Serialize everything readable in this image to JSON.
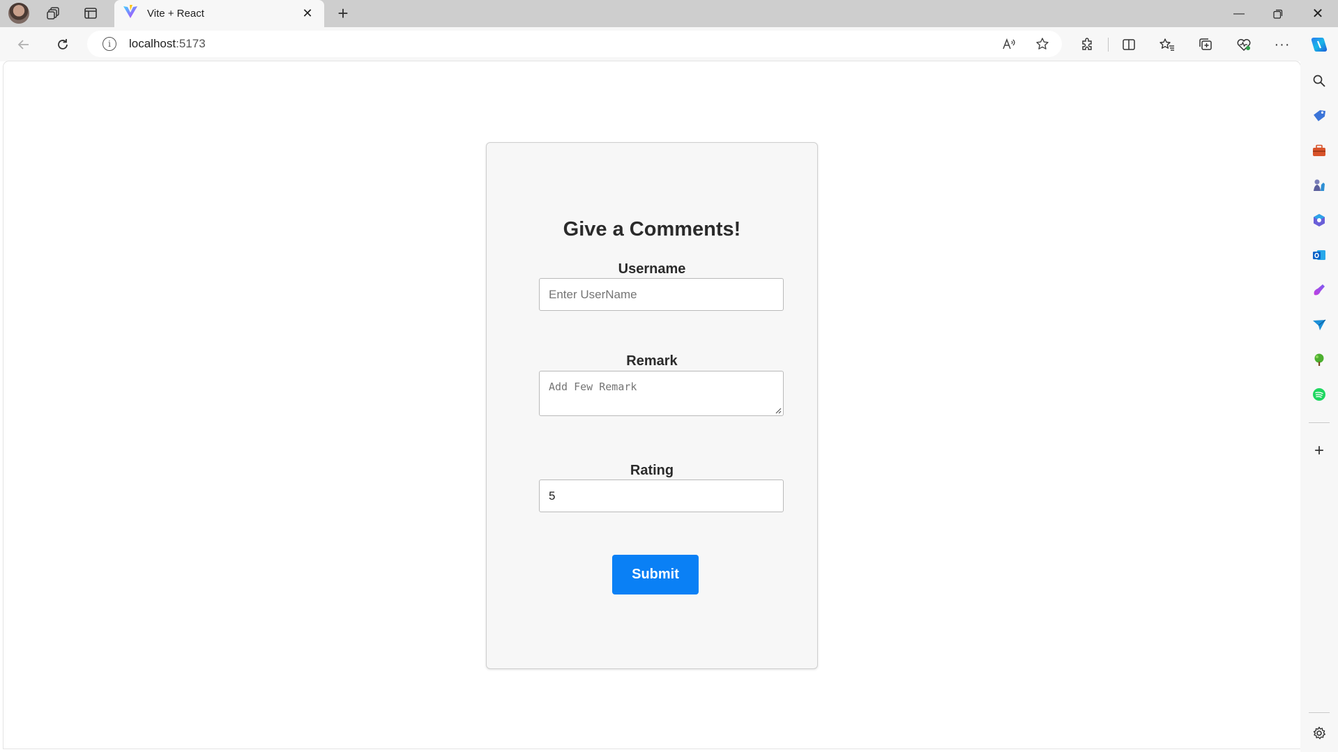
{
  "tab": {
    "title": "Vite + React"
  },
  "address": {
    "host": "localhost",
    "port": ":5173"
  },
  "form": {
    "heading": "Give a Comments!",
    "username_label": "Username",
    "username_placeholder": "Enter UserName",
    "remark_label": "Remark",
    "remark_placeholder": "Add Few Remark",
    "rating_label": "Rating",
    "rating_value": "5",
    "submit_label": "Submit"
  },
  "colors": {
    "accent": "#0a80f5",
    "card_bg": "#f7f7f7",
    "chrome_bg": "#cecece"
  }
}
